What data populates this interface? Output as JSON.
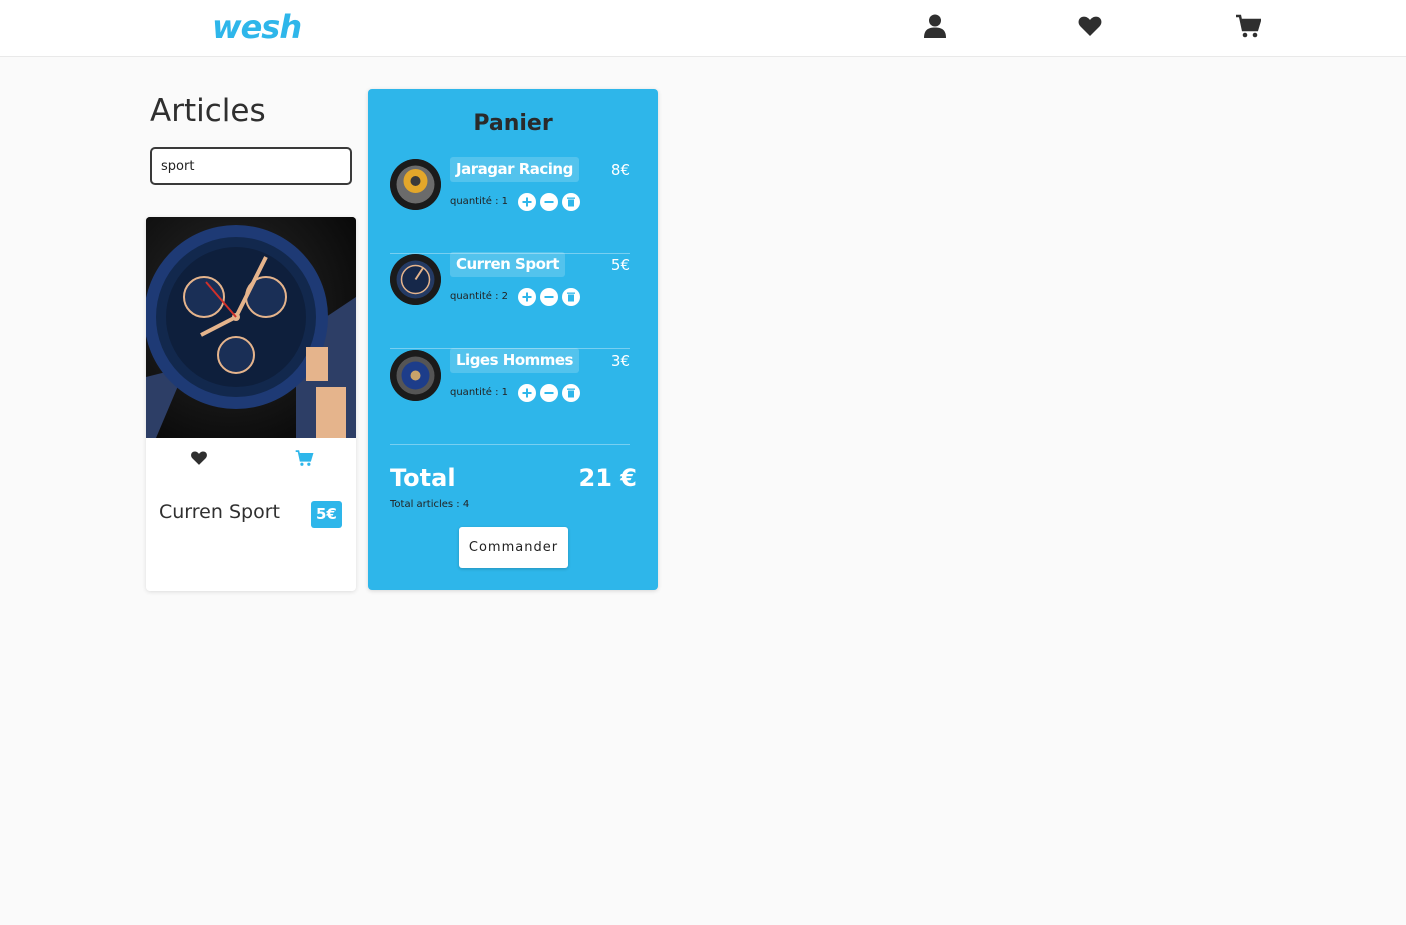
{
  "brand": {
    "logo_text": "wesh",
    "color": "#2eb6ea"
  },
  "header": {
    "icons": [
      "user-icon",
      "heart-icon",
      "cart-icon"
    ]
  },
  "main": {
    "title": "Articles",
    "search": {
      "value": "sport"
    }
  },
  "product": {
    "name": "Curren Sport",
    "price": "5€",
    "icons": [
      "heart-icon",
      "cart-icon"
    ]
  },
  "cart": {
    "title": "Panier",
    "items": [
      {
        "name": "Jaragar Racing",
        "price": "8€",
        "quantity_text": "quantité : 1"
      },
      {
        "name": "Curren Sport",
        "price": "5€",
        "quantity_text": "quantité : 2"
      },
      {
        "name": "Liges Hommes",
        "price": "3€",
        "quantity_text": "quantité : 1"
      }
    ],
    "total_label": "Total",
    "total_value": "21 €",
    "total_articles": "Total articles : 4",
    "order_button": "Commander"
  },
  "colors": {
    "accent": "#2eb6ea",
    "text": "#2f2f2f",
    "background": "#fafafa"
  }
}
